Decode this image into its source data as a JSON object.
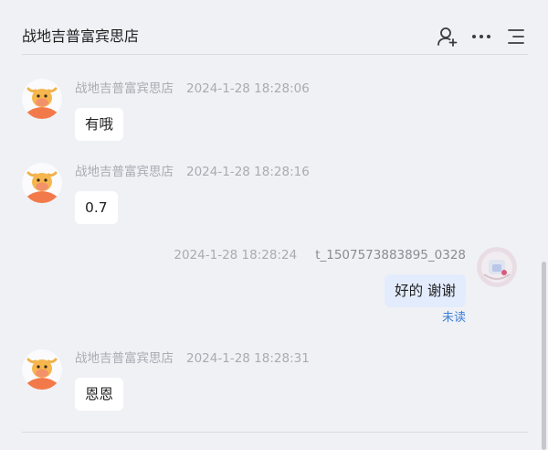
{
  "header": {
    "title": "战地吉普富宾思店",
    "icons": [
      "add-person-icon",
      "more-icon",
      "menu-list-icon"
    ]
  },
  "messages": [
    {
      "sender": "战地吉普富宾思店",
      "time": "2024-1-28 18:28:06",
      "text": "有哦",
      "side": "left"
    },
    {
      "sender": "战地吉普富宾思店",
      "time": "2024-1-28 18:28:16",
      "text": "0.7",
      "side": "left"
    },
    {
      "sender": "t_1507573883895_0328",
      "time": "2024-1-28 18:28:24",
      "text": "好的 谢谢",
      "side": "right",
      "status": "未读"
    },
    {
      "sender": "战地吉普富宾思店",
      "time": "2024-1-28 18:28:31",
      "text": "恩恩",
      "side": "left"
    }
  ],
  "colors": {
    "background": "#f0f1f5",
    "bubble_other": "#ffffff",
    "bubble_mine": "#e3ecfd",
    "unread": "#3b7fd9",
    "avatar_orange": "#f27a4a"
  }
}
